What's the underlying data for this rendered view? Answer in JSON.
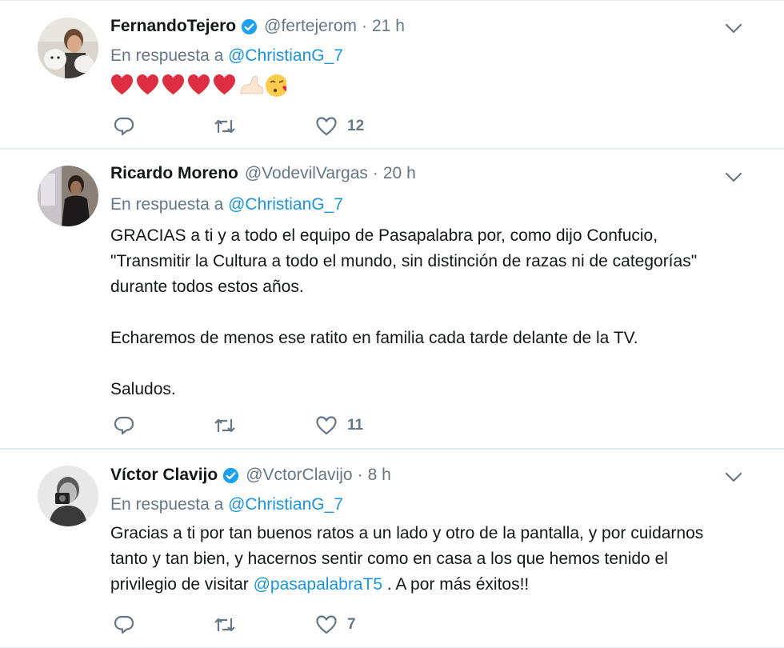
{
  "colors": {
    "link": "#1b95e0",
    "muted": "#657786",
    "heart": "#e0245e"
  },
  "tweets": [
    {
      "name": "FernandoTejero",
      "verified": true,
      "handle": "@fertejerom",
      "dot": "·",
      "time": "21 h",
      "reply_prefix": "En respuesta a",
      "reply_mention": "@ChristianG_7",
      "emoji": "hearts-flex-kiss",
      "like_count": "12"
    },
    {
      "name": "Ricardo Moreno",
      "verified": false,
      "handle": "@VodevilVargas",
      "dot": "·",
      "time": "20 h",
      "reply_prefix": "En respuesta a",
      "reply_mention": "@ChristianG_7",
      "text": "GRACIAS a ti y a todo el equipo de Pasapalabra por, como dijo Confucio,\n\"Transmitir la Cultura a todo el mundo, sin distinción de razas ni de categorías\"\ndurante todos estos años.\n\nEcharemos de menos ese ratito en familia cada tarde delante de la TV.\n\nSaludos.",
      "like_count": "11"
    },
    {
      "name": "Víctor Clavijo",
      "verified": true,
      "handle": "@VctorClavijo",
      "dot": "·",
      "time": "8 h",
      "reply_prefix": "En respuesta a",
      "reply_mention": "@ChristianG_7",
      "text_before": "Gracias a ti por tan buenos ratos a un lado y otro de la pantalla, y por cuidarnos\ntanto y tan bien, y hacernos sentir como en casa a los que hemos tenido el\nprivilegio de visitar ",
      "text_mention": "@pasapalabraT5",
      "text_after": " . A por más éxitos!!",
      "like_count": "7"
    }
  ]
}
